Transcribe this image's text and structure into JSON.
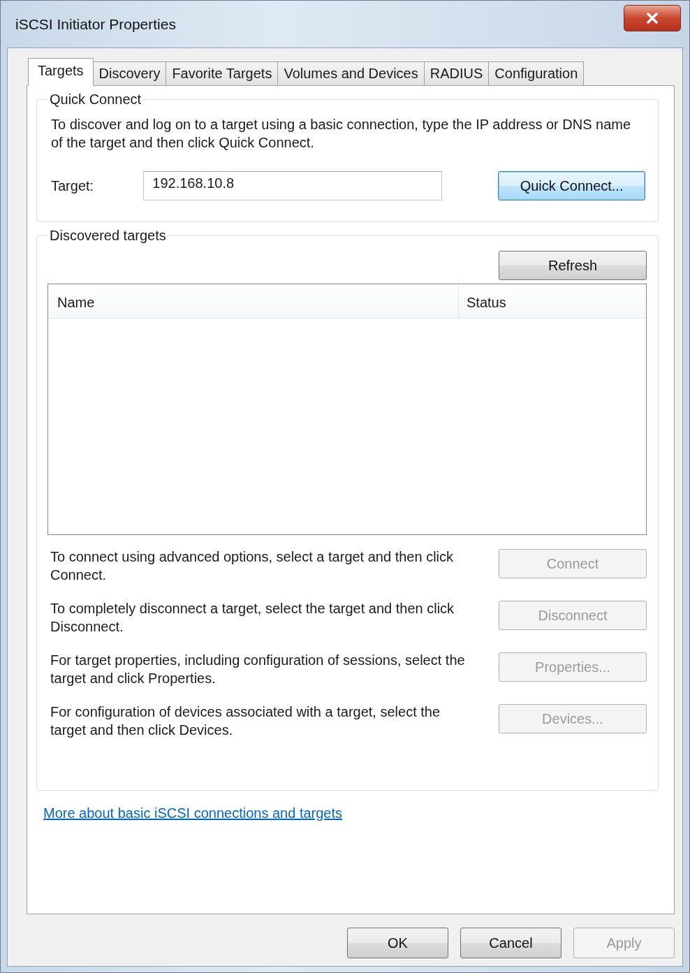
{
  "window": {
    "title": "iSCSI Initiator Properties"
  },
  "tabs": [
    {
      "label": "Targets",
      "selected": true
    },
    {
      "label": "Discovery",
      "selected": false
    },
    {
      "label": "Favorite Targets",
      "selected": false
    },
    {
      "label": "Volumes and Devices",
      "selected": false
    },
    {
      "label": "RADIUS",
      "selected": false
    },
    {
      "label": "Configuration",
      "selected": false
    }
  ],
  "quick_connect": {
    "title": "Quick Connect",
    "description": "To discover and log on to a target using a basic connection, type the IP address or DNS name of the target and then click Quick Connect.",
    "target_label": "Target:",
    "target_value": "192.168.10.8",
    "button": {
      "label": "Quick Connect...",
      "disabled": false,
      "focused": true
    }
  },
  "discovered_targets": {
    "title": "Discovered targets",
    "refresh_button": {
      "label": "Refresh",
      "disabled": false,
      "focused": false
    },
    "table": {
      "columns": [
        "Name",
        "Status"
      ]
    },
    "actions": [
      {
        "text": "To connect using advanced options, select a target and then click Connect.",
        "button": {
          "label": "Connect",
          "disabled": true,
          "focused": false
        }
      },
      {
        "text": "To completely disconnect a target, select the target and then click Disconnect.",
        "button": {
          "label": "Disconnect",
          "disabled": true,
          "focused": false
        }
      },
      {
        "text": "For target properties, including configuration of sessions, select the target and click Properties.",
        "button": {
          "label": "Properties...",
          "disabled": true,
          "focused": false
        }
      },
      {
        "text": "For configuration of devices associated with a target, select the target and then click Devices.",
        "button": {
          "label": "Devices...",
          "disabled": true,
          "focused": false
        }
      }
    ]
  },
  "link": "More about basic iSCSI connections and targets",
  "buttons": [
    {
      "label": "OK",
      "disabled": false,
      "focused": false
    },
    {
      "label": "Cancel",
      "disabled": false,
      "focused": false
    },
    {
      "label": "Apply",
      "disabled": true,
      "focused": false
    }
  ]
}
